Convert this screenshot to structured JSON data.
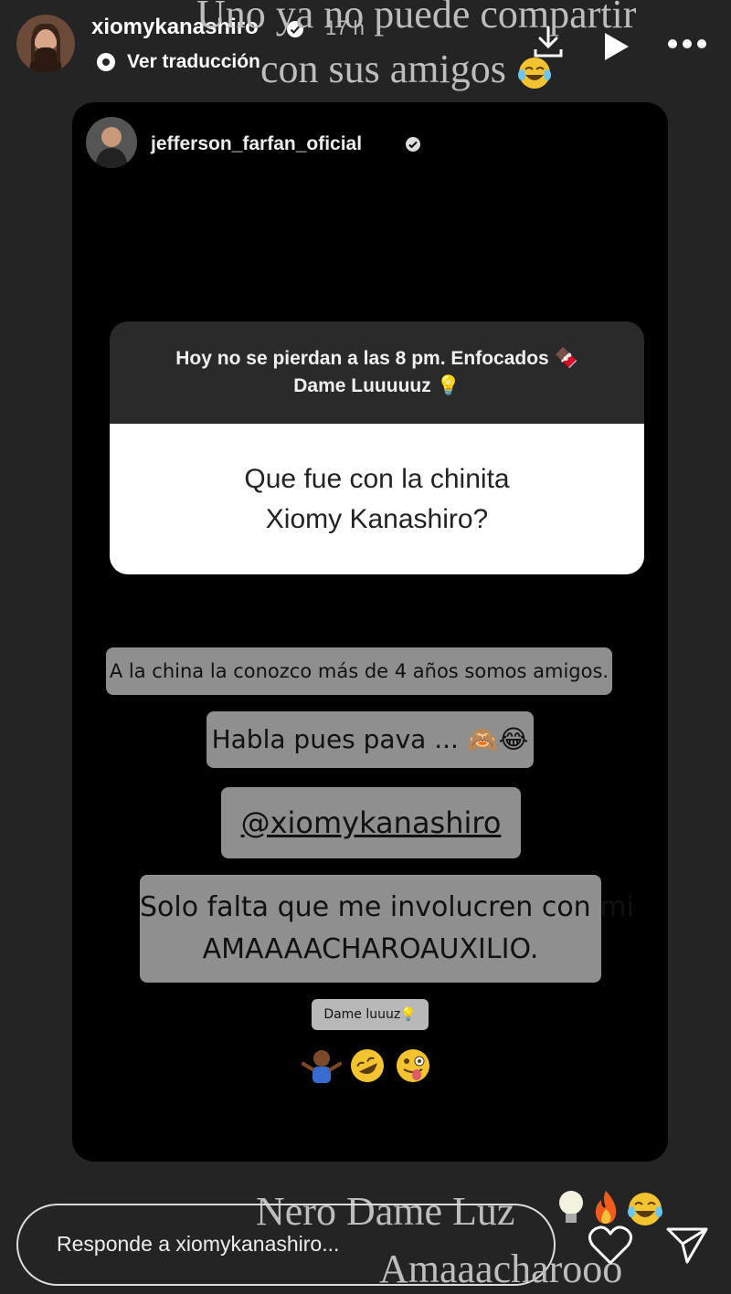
{
  "header": {
    "username": "xiomykanashiro",
    "time": "17 h",
    "translate_label": "Ver traducción"
  },
  "overlay": {
    "top_line1": "Uno ya no puede compartir",
    "top_line2": "con sus amigos",
    "bottom_line1": "Nero Dame Luz",
    "bottom_line2": "Amaaacharooo"
  },
  "shared_post": {
    "username": "jefferson_farfan_oficial",
    "question_prompt_line1": "Hoy no se pierdan a las 8 pm. Enfocados",
    "question_prompt_line2": "Dame Luuuuuz",
    "question_line1": "Que fue con la chinita",
    "question_line2": "Xiomy Kanashiro?",
    "caption1": "A la china la conozco más de 4 años somos amigos.",
    "caption2": "Habla pues pava ...",
    "caption3": "@xiomykanashiro",
    "caption4_line1": "Solo falta que me involucren con mi",
    "caption4_line2": "AMAAAACHAROAUXILIO.",
    "caption5": "Dame luuuz"
  },
  "footer": {
    "reply_placeholder": "Responde a xiomykanashiro..."
  },
  "icons": [
    "verified-icon",
    "translate-icon",
    "download-icon",
    "play-icon",
    "more-icon",
    "heart-icon",
    "send-icon"
  ]
}
